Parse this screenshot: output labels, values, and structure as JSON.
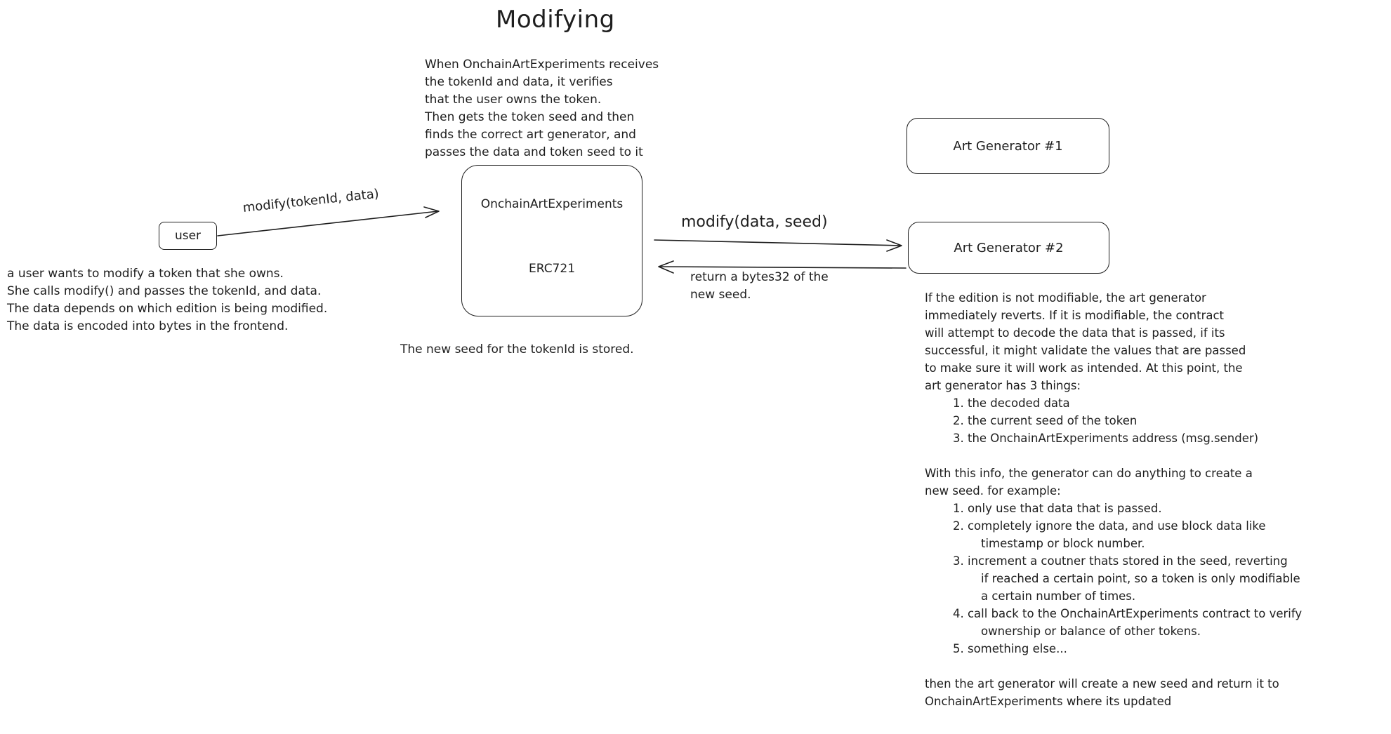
{
  "title": "Modifying",
  "nodes": {
    "user": "user",
    "contract_name": "OnchainArtExperiments",
    "contract_std": "ERC721",
    "gen1": "Art Generator #1",
    "gen2": "Art Generator #2"
  },
  "edges": {
    "user_to_contract": "modify(tokenId, data)",
    "contract_to_gen2": "modify(data, seed)",
    "gen2_to_contract": [
      "return a bytes32 of the",
      "new seed."
    ]
  },
  "notes": {
    "contract_top": [
      "When OnchainArtExperiments receives",
      "the tokenId and data, it verifies",
      "that the user owns the token.",
      "Then gets the token seed and then",
      "finds the correct art generator, and",
      "passes the data and token seed to it"
    ],
    "user_note": [
      "a user wants to modify a token that she owns.",
      "She calls modify() and passes the tokenId, and data.",
      "The data depends on which edition is being modified.",
      "The data is encoded into bytes in the frontend."
    ],
    "stored": "The new seed for the tokenId is stored.",
    "generator_intro": [
      "If the edition is not modifiable, the art generator",
      "immediately reverts. If it is modifiable, the contract",
      "will attempt to decode the data that is passed, if its",
      "successful, it might validate the values that are passed",
      "to make sure it will work as intended. At this point, the",
      "art generator has 3 things:"
    ],
    "generator_things": [
      "1. the decoded data",
      "2. the current seed of the token",
      "3. the OnchainArtExperiments address (msg.sender)"
    ],
    "examples_intro": [
      "With this info, the generator can do anything to create a",
      "new seed. for example:"
    ],
    "examples": [
      "1. only use that data that is passed.",
      "2. completely ignore the data, and use block data like",
      "timestamp or block number.",
      "3. increment a coutner thats stored in the seed, reverting",
      "if reached a certain point, so a token is only modifiable",
      "a certain number of times.",
      "4. call back to the OnchainArtExperiments contract to verify",
      "ownership or balance of other tokens.",
      "5. something else..."
    ],
    "outro": [
      "then the art generator will create a new seed and return it to",
      "OnchainArtExperiments where its updated"
    ]
  }
}
